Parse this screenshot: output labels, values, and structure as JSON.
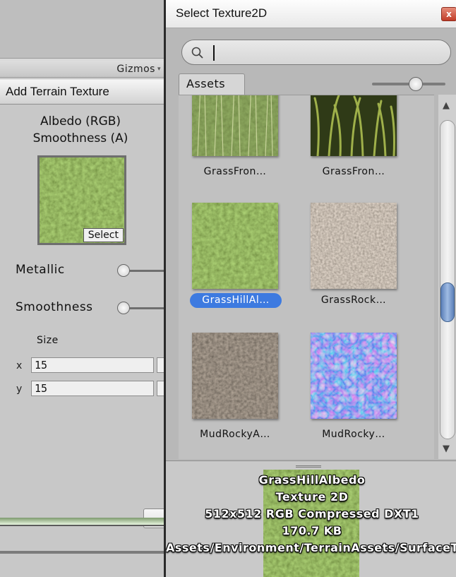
{
  "left_panel": {
    "gizmos_label": "Gizmos",
    "dialog_title": "Add Terrain Texture",
    "albedo_line1": "Albedo (RGB)",
    "albedo_line2": "Smoothness (A)",
    "select_label": "Select",
    "metallic_label": "Metallic",
    "metallic_value": 0,
    "smoothness_label": "Smoothness",
    "smoothness_value": 0,
    "size_label": "Size",
    "x_label": "x",
    "x_value": "15",
    "y_label": "y",
    "y_value": "15"
  },
  "picker": {
    "title": "Select Texture2D",
    "close_label": "x",
    "search_value": "",
    "tab_assets": "Assets",
    "zoom_level": 0.6,
    "items": [
      {
        "label": "GrassFron…",
        "icon": "grass-front-texture",
        "selected": false
      },
      {
        "label": "GrassFron…",
        "icon": "grass-front-texture",
        "selected": false
      },
      {
        "label": "GrassHillAl…",
        "icon": "grass-hill-albedo-texture",
        "selected": true
      },
      {
        "label": "GrassRock…",
        "icon": "grass-rocky-texture",
        "selected": false
      },
      {
        "label": "MudRockyA…",
        "icon": "mud-rocky-albedo-texture",
        "selected": false
      },
      {
        "label": "MudRocky…",
        "icon": "mud-rocky-normal-texture",
        "selected": false
      }
    ],
    "scroll_position": 0.58,
    "preview": {
      "name": "GrassHillAlbedo",
      "type": "Texture 2D",
      "info": "512x512  RGB Compressed DXT1",
      "size": "170.7 KB",
      "path": "Assets/Environment/TerrainAssets/SurfaceTextures"
    }
  },
  "colors": {
    "selection_blue": "#3d7ae0",
    "close_red": "#c13c28",
    "scroll_thumb_blue": "#5b7fb8",
    "panel_gray": "#c8c8c8"
  }
}
